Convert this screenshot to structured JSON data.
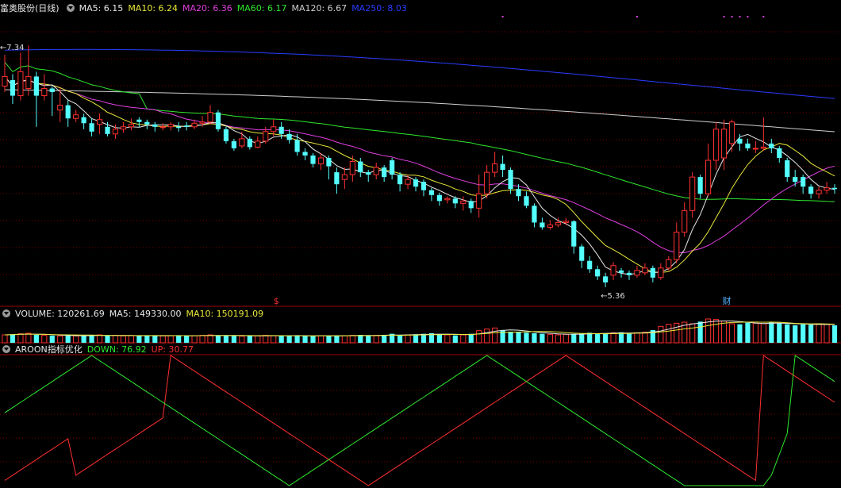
{
  "main_header": {
    "title": "富奥股份(日线)",
    "ma5": "MA5: 6.15",
    "ma10": "MA10: 6.24",
    "ma20": "MA20: 6.36",
    "ma60": "MA60: 6.17",
    "ma120": "MA120: 6.67",
    "ma250": "MA250: 8.03"
  },
  "volume_header": {
    "label": "VOLUME: 120261.69",
    "ma5": "MA5: 149330.00",
    "ma10": "MA10: 150191.09"
  },
  "aroon_header": {
    "label": "AROON指标优化",
    "down": "DOWN: 76.92",
    "up": "UP: 30.77"
  },
  "colors": {
    "up": "#ff3030",
    "down": "#54ffff",
    "ma5": "#e8e8e8",
    "ma10": "#e8e83a",
    "ma20": "#e040e0",
    "ma60": "#2ee82e",
    "ma120": "#cfcfcf",
    "ma250": "#2a3cff",
    "grid": "#7a0000",
    "aroon_down": "#2ee82e",
    "aroon_up": "#ff3030"
  },
  "chart_data": [
    {
      "type": "candlestick",
      "title": "富奥股份(日线)",
      "ylim": [
        5.2,
        7.6
      ],
      "annotations": [
        {
          "label": "7.34",
          "note": "high"
        },
        {
          "label": "5.36",
          "note": "low"
        },
        {
          "label": "$",
          "note": "marker"
        },
        {
          "label": "财",
          "note": "marker"
        }
      ],
      "candles": [
        [
          7.0,
          7.08,
          6.95,
          7.26
        ],
        [
          7.05,
          6.92,
          6.85,
          7.1
        ],
        [
          6.92,
          7.12,
          6.88,
          7.28
        ],
        [
          6.98,
          7.08,
          6.92,
          7.34
        ],
        [
          7.08,
          6.92,
          6.66,
          7.12
        ],
        [
          6.92,
          6.98,
          6.88,
          7.1
        ],
        [
          6.98,
          6.95,
          6.75,
          7.0
        ],
        [
          6.8,
          6.84,
          6.7,
          6.98
        ],
        [
          6.84,
          6.73,
          6.66,
          6.88
        ],
        [
          6.73,
          6.76,
          6.7,
          6.8
        ],
        [
          6.74,
          6.69,
          6.64,
          6.77
        ],
        [
          6.69,
          6.62,
          6.58,
          6.73
        ],
        [
          6.68,
          6.72,
          6.6,
          6.77
        ],
        [
          6.66,
          6.6,
          6.58,
          6.7
        ],
        [
          6.6,
          6.64,
          6.56,
          6.68
        ],
        [
          6.64,
          6.66,
          6.61,
          6.7
        ],
        [
          6.66,
          6.68,
          6.63,
          6.73
        ],
        [
          6.72,
          6.7,
          6.66,
          6.74
        ],
        [
          6.7,
          6.68,
          6.64,
          6.72
        ],
        [
          6.68,
          6.66,
          6.62,
          6.7
        ],
        [
          6.66,
          6.66,
          6.63,
          6.69
        ],
        [
          6.66,
          6.68,
          6.63,
          6.7
        ],
        [
          6.66,
          6.65,
          6.62,
          6.7
        ],
        [
          6.67,
          6.66,
          6.63,
          6.7
        ],
        [
          6.66,
          6.69,
          6.64,
          6.72
        ],
        [
          6.69,
          6.7,
          6.66,
          6.75
        ],
        [
          6.7,
          6.78,
          6.68,
          6.84
        ],
        [
          6.78,
          6.64,
          6.62,
          6.8
        ],
        [
          6.64,
          6.54,
          6.52,
          6.66
        ],
        [
          6.54,
          6.48,
          6.46,
          6.56
        ],
        [
          6.5,
          6.56,
          6.48,
          6.62
        ],
        [
          6.56,
          6.49,
          6.47,
          6.58
        ],
        [
          6.49,
          6.54,
          6.48,
          6.58
        ],
        [
          6.54,
          6.62,
          6.52,
          6.66
        ],
        [
          6.62,
          6.66,
          6.58,
          6.72
        ],
        [
          6.66,
          6.6,
          6.56,
          6.7
        ],
        [
          6.6,
          6.55,
          6.52,
          6.64
        ],
        [
          6.55,
          6.45,
          6.42,
          6.6
        ],
        [
          6.45,
          6.42,
          6.38,
          6.48
        ],
        [
          6.42,
          6.35,
          6.32,
          6.44
        ],
        [
          6.35,
          6.4,
          6.3,
          6.44
        ],
        [
          6.4,
          6.33,
          6.22,
          6.42
        ],
        [
          6.28,
          6.18,
          6.1,
          6.32
        ],
        [
          6.22,
          6.26,
          6.14,
          6.32
        ],
        [
          6.26,
          6.37,
          6.2,
          6.42
        ],
        [
          6.37,
          6.28,
          6.24,
          6.4
        ],
        [
          6.28,
          6.26,
          6.2,
          6.3
        ],
        [
          6.26,
          6.32,
          6.22,
          6.36
        ],
        [
          6.32,
          6.24,
          6.2,
          6.34
        ],
        [
          6.38,
          6.26,
          6.22,
          6.4
        ],
        [
          6.26,
          6.18,
          6.12,
          6.28
        ],
        [
          6.18,
          6.22,
          6.14,
          6.26
        ],
        [
          6.22,
          6.16,
          6.12,
          6.24
        ],
        [
          6.2,
          6.13,
          6.08,
          6.22
        ],
        [
          6.13,
          6.09,
          6.04,
          6.15
        ],
        [
          6.09,
          6.04,
          6.0,
          6.11
        ],
        [
          6.05,
          6.06,
          6.02,
          6.08
        ],
        [
          6.06,
          6.02,
          5.98,
          6.08
        ],
        [
          6.02,
          6.04,
          5.96,
          6.08
        ],
        [
          6.04,
          5.98,
          5.94,
          6.06
        ],
        [
          5.98,
          6.1,
          5.9,
          6.26
        ],
        [
          6.1,
          6.28,
          6.06,
          6.34
        ],
        [
          6.28,
          6.35,
          6.24,
          6.45
        ],
        [
          6.35,
          6.3,
          6.24,
          6.42
        ],
        [
          6.3,
          6.14,
          6.1,
          6.32
        ],
        [
          6.14,
          6.08,
          6.04,
          6.18
        ],
        [
          6.08,
          6.0,
          5.98,
          6.12
        ],
        [
          6.0,
          5.86,
          5.82,
          6.02
        ],
        [
          5.86,
          5.82,
          5.8,
          5.9
        ],
        [
          5.82,
          5.84,
          5.8,
          5.88
        ],
        [
          5.84,
          5.86,
          5.82,
          5.9
        ],
        [
          5.86,
          5.87,
          5.84,
          5.9
        ],
        [
          5.87,
          5.66,
          5.6,
          5.88
        ],
        [
          5.66,
          5.54,
          5.48,
          5.68
        ],
        [
          5.54,
          5.47,
          5.44,
          5.58
        ],
        [
          5.47,
          5.41,
          5.38,
          5.5
        ],
        [
          5.41,
          5.36,
          5.32,
          5.44
        ],
        [
          5.42,
          5.5,
          5.38,
          5.53
        ],
        [
          5.46,
          5.44,
          5.4,
          5.48
        ],
        [
          5.44,
          5.42,
          5.38,
          5.46
        ],
        [
          5.42,
          5.46,
          5.4,
          5.5
        ],
        [
          5.44,
          5.48,
          5.42,
          5.52
        ],
        [
          5.48,
          5.4,
          5.36,
          5.5
        ],
        [
          5.4,
          5.48,
          5.38,
          5.52
        ],
        [
          5.48,
          5.55,
          5.46,
          5.58
        ],
        [
          5.55,
          5.78,
          5.52,
          5.86
        ],
        [
          5.78,
          5.96,
          5.74,
          6.03
        ],
        [
          5.96,
          6.24,
          5.9,
          6.28
        ],
        [
          6.24,
          6.1,
          6.06,
          6.26
        ],
        [
          6.1,
          6.38,
          6.08,
          6.52
        ],
        [
          6.38,
          6.64,
          6.3,
          6.7
        ],
        [
          6.4,
          6.64,
          6.3,
          6.72
        ],
        [
          6.52,
          6.7,
          6.45,
          6.72
        ],
        [
          6.56,
          6.52,
          6.46,
          6.6
        ],
        [
          6.52,
          6.48,
          6.46,
          6.56
        ],
        [
          6.48,
          6.48,
          6.44,
          6.54
        ],
        [
          6.48,
          6.49,
          6.46,
          6.74
        ],
        [
          6.52,
          6.48,
          6.44,
          6.56
        ],
        [
          6.48,
          6.4,
          6.36,
          6.5
        ],
        [
          6.38,
          6.24,
          6.2,
          6.4
        ],
        [
          6.24,
          6.2,
          6.16,
          6.3
        ],
        [
          6.24,
          6.16,
          6.1,
          6.26
        ],
        [
          6.16,
          6.1,
          6.06,
          6.18
        ],
        [
          6.1,
          6.13,
          6.06,
          6.16
        ],
        [
          6.13,
          6.15,
          6.1,
          6.2
        ],
        [
          6.15,
          6.14,
          6.1,
          6.18
        ]
      ]
    },
    {
      "type": "bar",
      "title": "VOLUME",
      "values": [
        30,
        32,
        34,
        36,
        30,
        28,
        27,
        26,
        28,
        26,
        27,
        28,
        30,
        27,
        28,
        26,
        27,
        26,
        28,
        27,
        26,
        27,
        28,
        26,
        27,
        28,
        30,
        27,
        28,
        26,
        25,
        27,
        26,
        28,
        27,
        26,
        27,
        28,
        26,
        25,
        27,
        26,
        28,
        27,
        28,
        30,
        26,
        28,
        30,
        34,
        28,
        30,
        32,
        34,
        36,
        32,
        30,
        28,
        30,
        34,
        46,
        52,
        56,
        48,
        42,
        40,
        38,
        36,
        34,
        32,
        30,
        32,
        34,
        36,
        38,
        34,
        36,
        38,
        40,
        36,
        38,
        40,
        48,
        62,
        70,
        74,
        78,
        72,
        80,
        90,
        88,
        82,
        72,
        70,
        76,
        74,
        72,
        78,
        74,
        70,
        66,
        70,
        68,
        72,
        70,
        66
      ],
      "ma5": 149330.0,
      "ma10": 150191.09,
      "current": 120261.69
    },
    {
      "type": "line",
      "title": "AROON指标优化",
      "ylim": [
        0,
        100
      ],
      "series": [
        {
          "name": "DOWN",
          "values": [
            56,
            60,
            64,
            68,
            72,
            76,
            80,
            84,
            88,
            92,
            96,
            100,
            96,
            92,
            88,
            84,
            80,
            76,
            72,
            68,
            64,
            60,
            56,
            52,
            48,
            44,
            40,
            36,
            32,
            28,
            24,
            20,
            16,
            12,
            8,
            4,
            0,
            4,
            8,
            12,
            16,
            20,
            24,
            28,
            32,
            36,
            40,
            44,
            48,
            52,
            56,
            60,
            64,
            68,
            72,
            76,
            80,
            84,
            88,
            92,
            96,
            100,
            96,
            92,
            88,
            84,
            80,
            76,
            72,
            68,
            64,
            60,
            56,
            52,
            48,
            44,
            40,
            36,
            32,
            28,
            24,
            20,
            16,
            12,
            8,
            4,
            0,
            0,
            0,
            0,
            0,
            0,
            0,
            0,
            0,
            0,
            0,
            8,
            24,
            40,
            100,
            96,
            92,
            88,
            84,
            80
          ]
        },
        {
          "name": "UP",
          "values": [
            4,
            8,
            12,
            16,
            20,
            24,
            28,
            32,
            36,
            8,
            12,
            16,
            20,
            24,
            28,
            32,
            36,
            40,
            44,
            48,
            52,
            100,
            96,
            92,
            88,
            84,
            80,
            76,
            72,
            68,
            64,
            60,
            56,
            52,
            48,
            44,
            40,
            36,
            32,
            28,
            24,
            20,
            16,
            12,
            8,
            4,
            0,
            4,
            8,
            12,
            16,
            20,
            24,
            28,
            32,
            36,
            40,
            44,
            48,
            52,
            56,
            60,
            64,
            68,
            72,
            76,
            80,
            84,
            88,
            92,
            96,
            100,
            96,
            92,
            88,
            84,
            80,
            76,
            72,
            68,
            64,
            60,
            56,
            52,
            48,
            44,
            40,
            36,
            32,
            28,
            24,
            20,
            16,
            12,
            8,
            4,
            100,
            96,
            92,
            88,
            84,
            80,
            76,
            72,
            68,
            64
          ]
        }
      ]
    }
  ]
}
